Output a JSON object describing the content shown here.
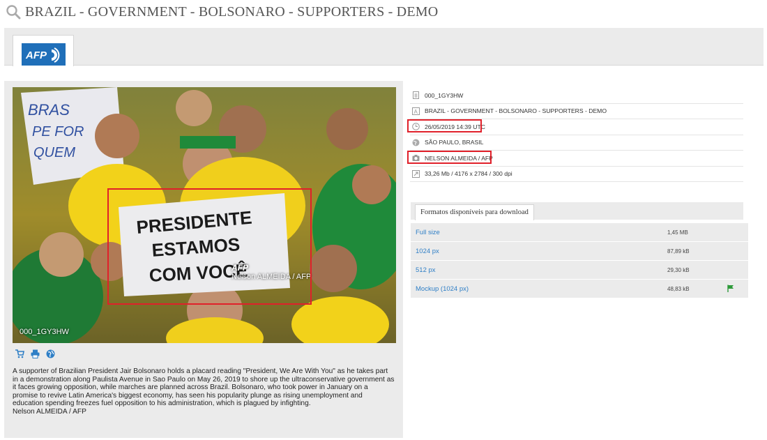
{
  "page": {
    "title": "BRAZIL - GOVERNMENT - BOLSONARO - SUPPORTERS - DEMO"
  },
  "tabs": [
    {
      "label": "AFP",
      "icon": "afp-logo"
    }
  ],
  "photo": {
    "ref": "000_1GY3HW",
    "overlay_brand": "AFP",
    "overlay_credit": "Nelson ALMEIDA / AFP",
    "placard_lines": [
      "PRESIDENTE",
      "ESTAMOS",
      "COM VOCÊ"
    ]
  },
  "actions": [
    {
      "icon": "cart-icon"
    },
    {
      "icon": "print-icon"
    },
    {
      "icon": "globe-icon"
    }
  ],
  "caption": {
    "text": "A supporter of Brazilian President Jair Bolsonaro holds a placard reading \"President, We Are With You\" as he takes part in a demonstration along Paulista Avenue in Sao Paulo on May 26, 2019 to shore up the ultraconservative government as it faces growing opposition, while marches are planned across Brazil. Bolsonaro, who took power in January on a promise to revive Latin America's biggest economy, has seen his popularity plunge as rising unemployment and education spending freezes fuel opposition to his administration, which is plagued by infighting.",
    "credit": "Nelson ALMEIDA / AFP"
  },
  "meta": {
    "ref": "000_1GY3HW",
    "headline": "BRAZIL - GOVERNMENT - BOLSONARO - SUPPORTERS - DEMO",
    "date": "26/05/2019 14:39 UTC",
    "location": "SÃO PAULO, BRASIL",
    "photographer": "NELSON ALMEIDA / AFP",
    "specs": "33,26 Mb / 4176 x 2784 / 300 dpi"
  },
  "downloads": {
    "tab_label": "Formatos disponíveis para download",
    "rows": [
      {
        "label": "Full size",
        "size": "1,45 MB",
        "flag": false
      },
      {
        "label": "1024 px",
        "size": "87,89 kB",
        "flag": false
      },
      {
        "label": "512 px",
        "size": "29,30 kB",
        "flag": false
      },
      {
        "label": "Mockup (1024 px)",
        "size": "48,83 kB",
        "flag": true
      }
    ]
  },
  "colors": {
    "accent_link": "#2f7fc6",
    "afp_blue": "#1f6fb9",
    "highlight": "#e0202a",
    "flag_green": "#2e9a3a"
  }
}
